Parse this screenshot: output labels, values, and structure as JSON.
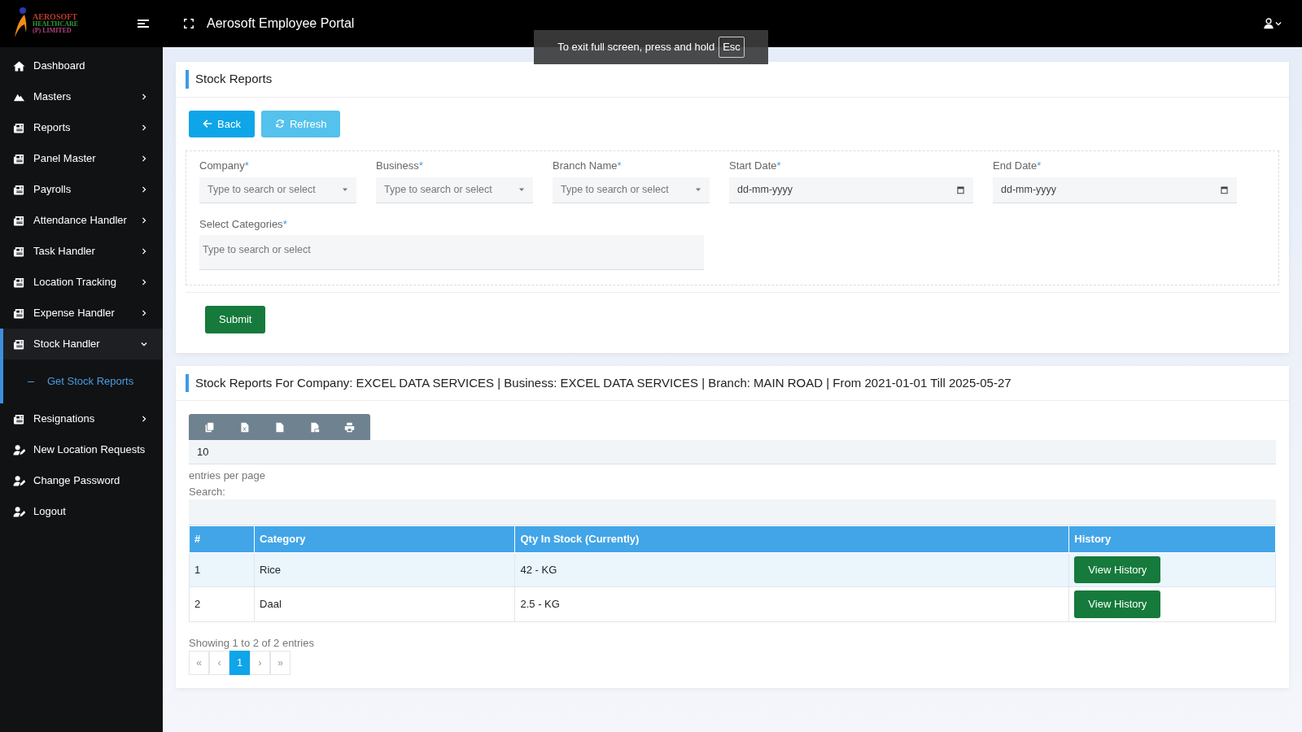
{
  "topbar": {
    "logo_lines": [
      "AEROSOFT",
      "HEALTHCARE",
      "(P) LIMITED"
    ],
    "title": "Aerosoft Employee Portal"
  },
  "fullscreen_notice": {
    "text": "To exit full screen, press and hold",
    "key": "Esc"
  },
  "sidebar": {
    "items": [
      {
        "label": "Dashboard",
        "kind": "home",
        "has_chevron": false,
        "selected": false
      },
      {
        "label": "Masters",
        "kind": "masters",
        "has_chevron": true,
        "expanded": false,
        "selected": false
      },
      {
        "label": "Reports",
        "kind": "report",
        "has_chevron": true,
        "expanded": false,
        "selected": false
      },
      {
        "label": "Panel Master",
        "kind": "report",
        "has_chevron": true,
        "expanded": false,
        "selected": false
      },
      {
        "label": "Payrolls",
        "kind": "report",
        "has_chevron": true,
        "expanded": false,
        "selected": false
      },
      {
        "label": "Attendance Handler",
        "kind": "report",
        "has_chevron": true,
        "expanded": false,
        "selected": false
      },
      {
        "label": "Task Handler",
        "kind": "report",
        "has_chevron": true,
        "expanded": false,
        "selected": false
      },
      {
        "label": "Location Tracking",
        "kind": "report",
        "has_chevron": true,
        "expanded": false,
        "selected": false
      },
      {
        "label": "Expense Handler",
        "kind": "report",
        "has_chevron": true,
        "expanded": false,
        "selected": false
      },
      {
        "label": "Stock Handler",
        "kind": "report",
        "has_chevron": true,
        "expanded": true,
        "selected": true,
        "children": [
          {
            "label": "Get Stock Reports",
            "selected": true
          }
        ]
      },
      {
        "label": "Resignations",
        "kind": "report",
        "has_chevron": true,
        "expanded": false,
        "selected": false
      },
      {
        "label": "New Location Requests",
        "kind": "user",
        "has_chevron": false,
        "selected": false
      },
      {
        "label": "Change Password",
        "kind": "user",
        "has_chevron": false,
        "selected": false
      },
      {
        "label": "Logout",
        "kind": "user",
        "has_chevron": false,
        "selected": false
      }
    ]
  },
  "filter_card": {
    "title": "Stock Reports",
    "buttons": [
      {
        "label": "Back",
        "kind": "back"
      },
      {
        "label": "Refresh",
        "kind": "refresh"
      }
    ],
    "fields": [
      {
        "label": "Company",
        "kind": "select",
        "placeholder": "Type to search or select"
      },
      {
        "label": "Business",
        "kind": "select",
        "placeholder": "Type to search or select"
      },
      {
        "label": "Branch Name",
        "kind": "select",
        "placeholder": "Type to search or select"
      },
      {
        "label": "Start Date",
        "kind": "date",
        "placeholder": "dd-mm-yyyy"
      },
      {
        "label": "End Date",
        "kind": "date",
        "placeholder": "dd-mm-yyyy"
      },
      {
        "label": "Select Categories",
        "kind": "multi",
        "placeholder": "Type to search or select"
      }
    ],
    "required_mark": "*",
    "submit": "Submit"
  },
  "results_card": {
    "title": "Stock Reports For Company: EXCEL DATA SERVICES | Business: EXCEL DATA SERVICES | Branch: MAIN ROAD | From 2021-01-01 Till 2025-05-27",
    "export_buttons": [
      {
        "kind": "copy"
      },
      {
        "kind": "excel"
      },
      {
        "kind": "csv"
      },
      {
        "kind": "pdf"
      },
      {
        "kind": "print"
      }
    ],
    "page_size": "10",
    "page_size_label": "entries per page",
    "search_label": "Search:",
    "table": {
      "columns": [
        "#",
        "Category",
        "Qty In Stock (Currently)",
        "History"
      ],
      "rows": [
        {
          "cells": [
            "1",
            "Rice",
            "42 - KG"
          ],
          "action": "View History"
        },
        {
          "cells": [
            "2",
            "Daal",
            "2.5 - KG"
          ],
          "action": "View History"
        }
      ]
    },
    "info": "Showing 1 to 2 of 2 entries",
    "pagination": [
      {
        "label": "«",
        "selected": false
      },
      {
        "label": "‹",
        "selected": false
      },
      {
        "label": "1",
        "selected": true
      },
      {
        "label": "›",
        "selected": false
      },
      {
        "label": "»",
        "selected": false
      }
    ]
  }
}
